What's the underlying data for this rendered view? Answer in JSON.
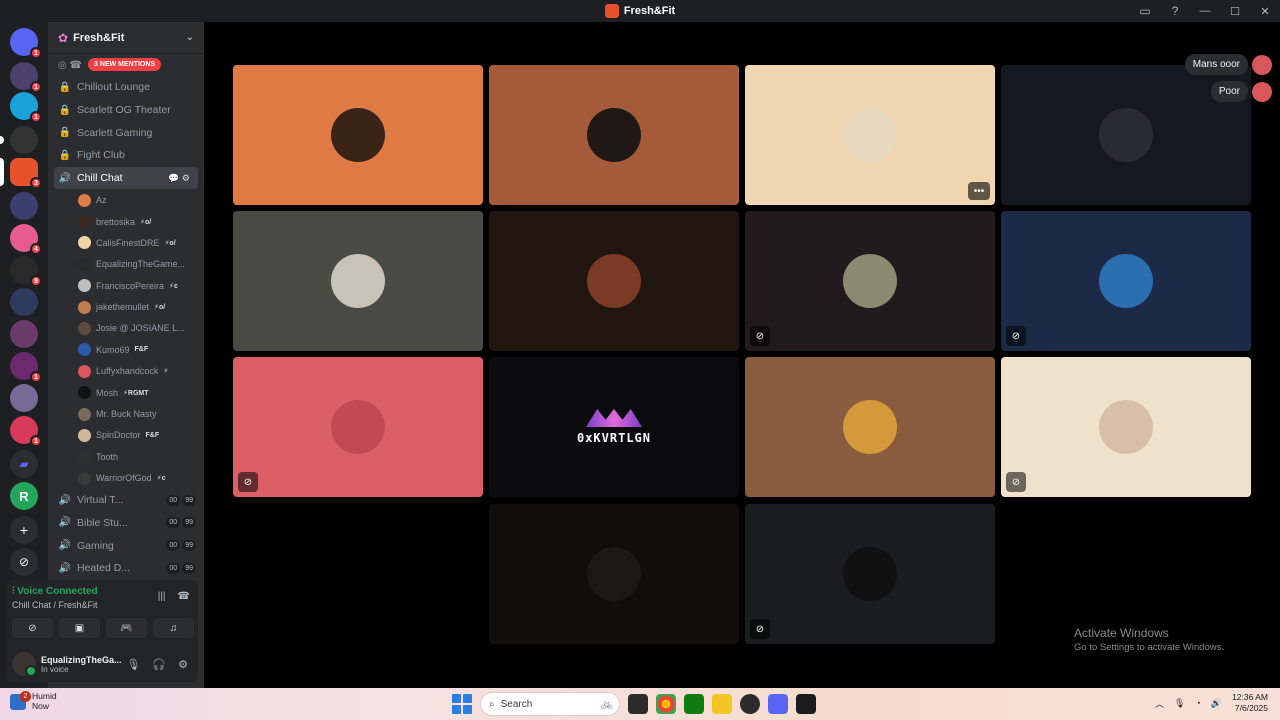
{
  "window": {
    "title": "Fresh&Fit"
  },
  "guild": {
    "name": "Fresh&Fit",
    "mentions_label": "3 NEW MENTIONS"
  },
  "channels": [
    {
      "name": "Chillout Lounge",
      "locked": true
    },
    {
      "name": "Scarlett OG Theater",
      "locked": true
    },
    {
      "name": "Scarlett Gaming",
      "locked": true
    },
    {
      "name": "Fight Club",
      "locked": true
    },
    {
      "name": "Chill Chat",
      "locked": false,
      "active": true
    }
  ],
  "voice_users": [
    {
      "name": "Az",
      "tag": "",
      "color": "#e07b4a"
    },
    {
      "name": "brettosika",
      "tag": "⚡o/",
      "color": "#3b2a20"
    },
    {
      "name": "CalisFinestDRE",
      "tag": "⚡o/",
      "color": "#f0d4a8"
    },
    {
      "name": "EqualizingTheGame...",
      "tag": "",
      "color": "#2a2a2a"
    },
    {
      "name": "FranciscoPereira",
      "tag": "⚡c",
      "color": "#bfbfbf"
    },
    {
      "name": "jakethemullet",
      "tag": "⚡o/",
      "color": "#c07a50"
    },
    {
      "name": "Josie @ JOSIANE L...",
      "tag": "",
      "color": "#5b4a3f"
    },
    {
      "name": "Kumo69",
      "tag": "F&F",
      "color": "#2a5aa8"
    },
    {
      "name": "Luffyxhandcock",
      "tag": "⚡",
      "color": "#d8575d"
    },
    {
      "name": "Mosh",
      "tag": "⚡RGMT",
      "color": "#111111"
    },
    {
      "name": "Mr. Buck Nasty",
      "tag": "",
      "color": "#7a6a5a"
    },
    {
      "name": "SpinDoctor",
      "tag": "F&F",
      "color": "#cdb89a"
    },
    {
      "name": "Tooth",
      "tag": "",
      "color": "#2f2f2f"
    },
    {
      "name": "WarriorOfGod",
      "tag": "⚡c",
      "color": "#3a3a3a"
    }
  ],
  "voice_channels": [
    {
      "name": "Virtual T...",
      "count_a": "00",
      "count_b": "99"
    },
    {
      "name": "Bible Stu...",
      "count_a": "00",
      "count_b": "99"
    },
    {
      "name": "Gaming",
      "count_a": "00",
      "count_b": "99"
    },
    {
      "name": "Heated D...",
      "count_a": "00",
      "count_b": "99"
    }
  ],
  "voice_panel": {
    "status": "Voice Connected",
    "location": "Chill Chat / Fresh&Fit"
  },
  "user": {
    "name": "EqualizingTheGa...",
    "status": "In voice"
  },
  "chat": [
    {
      "text": "Mans ooor"
    },
    {
      "text": "Poor"
    }
  ],
  "tiles": [
    {
      "bg": "#e07a45",
      "avatar": "#3a2418",
      "mute": false,
      "more": false
    },
    {
      "bg": "#a55a3a",
      "avatar": "#201815",
      "mute": false,
      "more": false
    },
    {
      "bg": "#f0d6b0",
      "avatar": "#e8d8c0",
      "mute": false,
      "more": true
    },
    {
      "bg": "#141821",
      "avatar": "#2a2a35",
      "mute": false,
      "more": false
    },
    {
      "bg": "#4b4b45",
      "avatar": "#c9c2b8",
      "mute": false,
      "more": false
    },
    {
      "bg": "#21150f",
      "avatar": "#7a3a25",
      "mute": false,
      "more": false
    },
    {
      "bg": "#221a1d",
      "avatar": "#8a8a70",
      "mute": true,
      "more": false
    },
    {
      "bg": "#1c2a47",
      "avatar": "#2a6fb0",
      "mute": true,
      "more": false
    },
    {
      "bg": "#dc5f66",
      "avatar": "#c24b52",
      "mute": true,
      "more": false
    },
    {
      "bg": "#0c0b0e",
      "avatar": "",
      "mute": false,
      "more": false,
      "logo": "0xKVRTLGN"
    },
    {
      "bg": "#8a5c3f",
      "avatar": "#d49a3a",
      "mute": false,
      "more": false
    },
    {
      "bg": "#efe2cc",
      "avatar": "#d8c0a8",
      "mute": true,
      "more": false
    },
    {
      "bg": "#110d0b",
      "avatar": "#1e1814",
      "mute": false,
      "more": false
    },
    {
      "bg": "#191d1d",
      "avatar": "#111111",
      "mute": true,
      "more": false
    }
  ],
  "watermark": {
    "line1": "Activate Windows",
    "line2": "Go to Settings to activate Windows."
  },
  "taskbar": {
    "weather_title": "Humid",
    "weather_sub": "Now",
    "weather_badge": "2",
    "search_placeholder": "Search",
    "time": "12:36 AM",
    "date": "7/6/2025"
  }
}
